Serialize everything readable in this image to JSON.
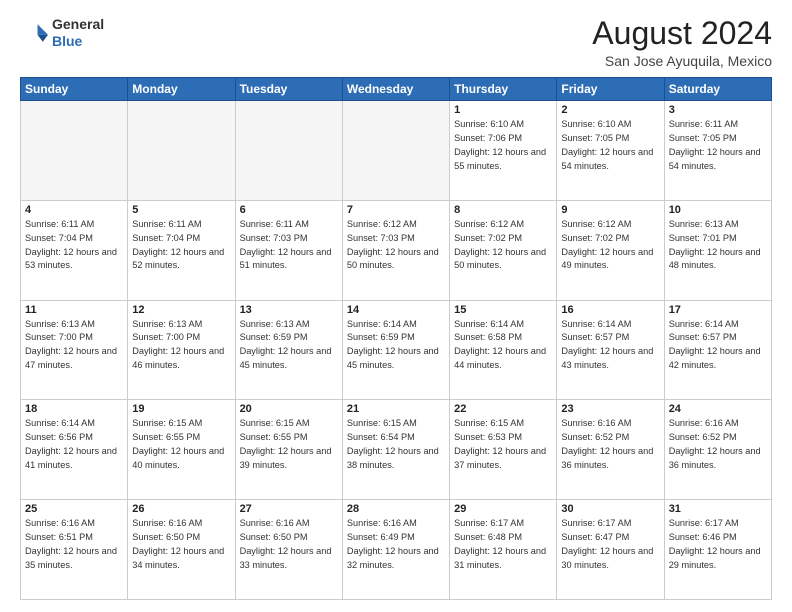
{
  "logo": {
    "general": "General",
    "blue": "Blue"
  },
  "title": "August 2024",
  "location": "San Jose Ayuquila, Mexico",
  "days_of_week": [
    "Sunday",
    "Monday",
    "Tuesday",
    "Wednesday",
    "Thursday",
    "Friday",
    "Saturday"
  ],
  "weeks": [
    [
      {
        "day": "",
        "empty": true
      },
      {
        "day": "",
        "empty": true
      },
      {
        "day": "",
        "empty": true
      },
      {
        "day": "",
        "empty": true
      },
      {
        "day": "1",
        "sunrise": "6:10 AM",
        "sunset": "7:06 PM",
        "daylight": "12 hours and 55 minutes."
      },
      {
        "day": "2",
        "sunrise": "6:10 AM",
        "sunset": "7:05 PM",
        "daylight": "12 hours and 54 minutes."
      },
      {
        "day": "3",
        "sunrise": "6:11 AM",
        "sunset": "7:05 PM",
        "daylight": "12 hours and 54 minutes."
      }
    ],
    [
      {
        "day": "4",
        "sunrise": "6:11 AM",
        "sunset": "7:04 PM",
        "daylight": "12 hours and 53 minutes."
      },
      {
        "day": "5",
        "sunrise": "6:11 AM",
        "sunset": "7:04 PM",
        "daylight": "12 hours and 52 minutes."
      },
      {
        "day": "6",
        "sunrise": "6:11 AM",
        "sunset": "7:03 PM",
        "daylight": "12 hours and 51 minutes."
      },
      {
        "day": "7",
        "sunrise": "6:12 AM",
        "sunset": "7:03 PM",
        "daylight": "12 hours and 50 minutes."
      },
      {
        "day": "8",
        "sunrise": "6:12 AM",
        "sunset": "7:02 PM",
        "daylight": "12 hours and 50 minutes."
      },
      {
        "day": "9",
        "sunrise": "6:12 AM",
        "sunset": "7:02 PM",
        "daylight": "12 hours and 49 minutes."
      },
      {
        "day": "10",
        "sunrise": "6:13 AM",
        "sunset": "7:01 PM",
        "daylight": "12 hours and 48 minutes."
      }
    ],
    [
      {
        "day": "11",
        "sunrise": "6:13 AM",
        "sunset": "7:00 PM",
        "daylight": "12 hours and 47 minutes."
      },
      {
        "day": "12",
        "sunrise": "6:13 AM",
        "sunset": "7:00 PM",
        "daylight": "12 hours and 46 minutes."
      },
      {
        "day": "13",
        "sunrise": "6:13 AM",
        "sunset": "6:59 PM",
        "daylight": "12 hours and 45 minutes."
      },
      {
        "day": "14",
        "sunrise": "6:14 AM",
        "sunset": "6:59 PM",
        "daylight": "12 hours and 45 minutes."
      },
      {
        "day": "15",
        "sunrise": "6:14 AM",
        "sunset": "6:58 PM",
        "daylight": "12 hours and 44 minutes."
      },
      {
        "day": "16",
        "sunrise": "6:14 AM",
        "sunset": "6:57 PM",
        "daylight": "12 hours and 43 minutes."
      },
      {
        "day": "17",
        "sunrise": "6:14 AM",
        "sunset": "6:57 PM",
        "daylight": "12 hours and 42 minutes."
      }
    ],
    [
      {
        "day": "18",
        "sunrise": "6:14 AM",
        "sunset": "6:56 PM",
        "daylight": "12 hours and 41 minutes."
      },
      {
        "day": "19",
        "sunrise": "6:15 AM",
        "sunset": "6:55 PM",
        "daylight": "12 hours and 40 minutes."
      },
      {
        "day": "20",
        "sunrise": "6:15 AM",
        "sunset": "6:55 PM",
        "daylight": "12 hours and 39 minutes."
      },
      {
        "day": "21",
        "sunrise": "6:15 AM",
        "sunset": "6:54 PM",
        "daylight": "12 hours and 38 minutes."
      },
      {
        "day": "22",
        "sunrise": "6:15 AM",
        "sunset": "6:53 PM",
        "daylight": "12 hours and 37 minutes."
      },
      {
        "day": "23",
        "sunrise": "6:16 AM",
        "sunset": "6:52 PM",
        "daylight": "12 hours and 36 minutes."
      },
      {
        "day": "24",
        "sunrise": "6:16 AM",
        "sunset": "6:52 PM",
        "daylight": "12 hours and 36 minutes."
      }
    ],
    [
      {
        "day": "25",
        "sunrise": "6:16 AM",
        "sunset": "6:51 PM",
        "daylight": "12 hours and 35 minutes."
      },
      {
        "day": "26",
        "sunrise": "6:16 AM",
        "sunset": "6:50 PM",
        "daylight": "12 hours and 34 minutes."
      },
      {
        "day": "27",
        "sunrise": "6:16 AM",
        "sunset": "6:50 PM",
        "daylight": "12 hours and 33 minutes."
      },
      {
        "day": "28",
        "sunrise": "6:16 AM",
        "sunset": "6:49 PM",
        "daylight": "12 hours and 32 minutes."
      },
      {
        "day": "29",
        "sunrise": "6:17 AM",
        "sunset": "6:48 PM",
        "daylight": "12 hours and 31 minutes."
      },
      {
        "day": "30",
        "sunrise": "6:17 AM",
        "sunset": "6:47 PM",
        "daylight": "12 hours and 30 minutes."
      },
      {
        "day": "31",
        "sunrise": "6:17 AM",
        "sunset": "6:46 PM",
        "daylight": "12 hours and 29 minutes."
      }
    ]
  ]
}
